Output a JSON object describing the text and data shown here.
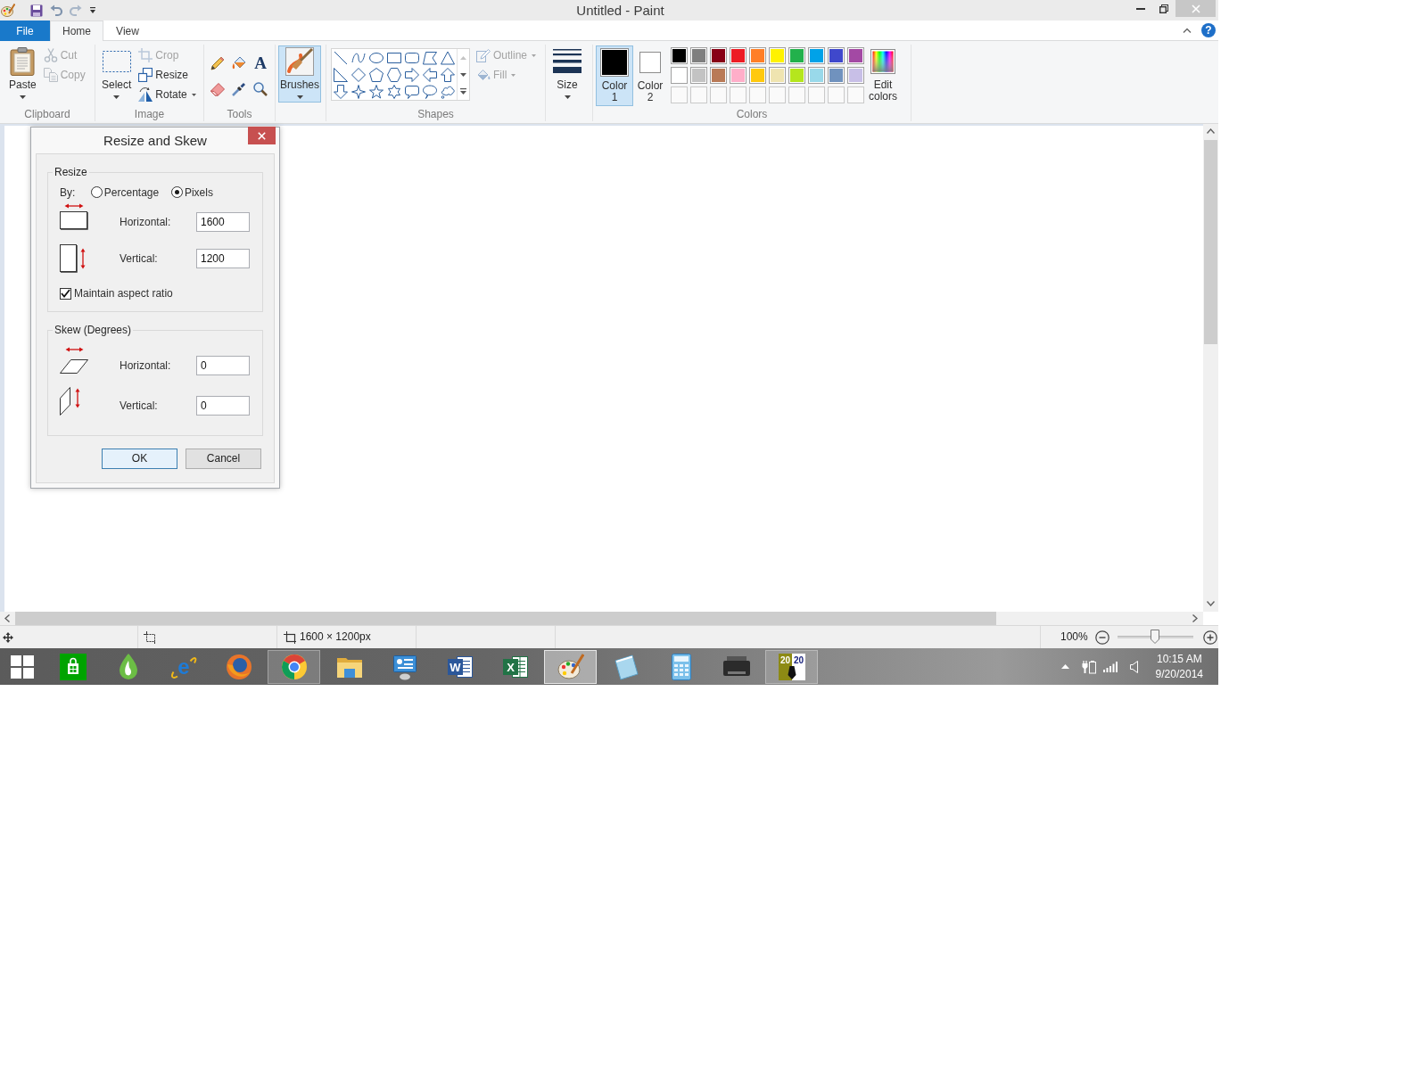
{
  "window": {
    "title": "Untitled - Paint"
  },
  "ribbon_tabs": [
    {
      "label": "File",
      "kind": "file",
      "selected": false
    },
    {
      "label": "Home",
      "kind": "tab",
      "selected": true
    },
    {
      "label": "View",
      "kind": "tab",
      "selected": false
    }
  ],
  "help_button": {
    "label": "?"
  },
  "ribbon": {
    "clipboard": {
      "title": "Clipboard",
      "paste": {
        "label": "Paste"
      },
      "cut": {
        "label": "Cut",
        "disabled": true
      },
      "copy": {
        "label": "Copy",
        "disabled": true
      }
    },
    "image": {
      "title": "Image",
      "select": {
        "label": "Select"
      },
      "crop": {
        "label": "Crop",
        "disabled": true
      },
      "resize": {
        "label": "Resize",
        "disabled": false
      },
      "rotate": {
        "label": "Rotate",
        "disabled": false
      }
    },
    "tools": {
      "title": "Tools",
      "text_tool": {
        "glyph": "A"
      }
    },
    "brushes": {
      "label": "Brushes",
      "selected": true
    },
    "shapes": {
      "title": "Shapes",
      "outline": {
        "label": "Outline",
        "disabled": true
      },
      "fill": {
        "label": "Fill",
        "disabled": true
      }
    },
    "size": {
      "label": "Size"
    },
    "colors": {
      "title": "Colors",
      "color_1": {
        "label": "Color 1",
        "color": "#000000",
        "selected": true
      },
      "color_2": {
        "label": "Color 2",
        "color": "#ffffff",
        "selected": false
      },
      "palette": [
        {
          "kind": "swatch",
          "color": "#000000"
        },
        {
          "kind": "swatch",
          "color": "#7f7f7f"
        },
        {
          "kind": "swatch",
          "color": "#880015"
        },
        {
          "kind": "swatch",
          "color": "#ed1c24"
        },
        {
          "kind": "swatch",
          "color": "#ff7f27"
        },
        {
          "kind": "swatch",
          "color": "#fff200"
        },
        {
          "kind": "swatch",
          "color": "#22b14c"
        },
        {
          "kind": "swatch",
          "color": "#00a2e8"
        },
        {
          "kind": "swatch",
          "color": "#3f48cc"
        },
        {
          "kind": "swatch",
          "color": "#a349a4"
        },
        {
          "kind": "swatch",
          "color": "#ffffff"
        },
        {
          "kind": "swatch",
          "color": "#c3c3c3"
        },
        {
          "kind": "swatch",
          "color": "#b97a57"
        },
        {
          "kind": "swatch",
          "color": "#ffaec9"
        },
        {
          "kind": "swatch",
          "color": "#ffc90e"
        },
        {
          "kind": "swatch",
          "color": "#efe4b0"
        },
        {
          "kind": "swatch",
          "color": "#b5e61d"
        },
        {
          "kind": "swatch",
          "color": "#99d9ea"
        },
        {
          "kind": "swatch",
          "color": "#7092be"
        },
        {
          "kind": "swatch",
          "color": "#c8bfe7"
        },
        {
          "kind": "empty"
        },
        {
          "kind": "empty"
        },
        {
          "kind": "empty"
        },
        {
          "kind": "empty"
        },
        {
          "kind": "empty"
        },
        {
          "kind": "empty"
        },
        {
          "kind": "empty"
        },
        {
          "kind": "empty"
        },
        {
          "kind": "empty"
        },
        {
          "kind": "empty"
        }
      ],
      "edit_colors": {
        "label": "Edit colors"
      }
    }
  },
  "dialog": {
    "title": "Resize and Skew",
    "resize": {
      "title": "Resize",
      "by_label": "By:",
      "options": [
        {
          "label": "Percentage",
          "selected": false
        },
        {
          "label": "Pixels",
          "selected": true
        }
      ],
      "fields": [
        {
          "kind": "horizontal",
          "label": "Horizontal:",
          "value": "1600"
        },
        {
          "kind": "vertical",
          "label": "Vertical:",
          "value": "1200"
        }
      ],
      "maintain_aspect_ratio": {
        "label": "Maintain aspect ratio",
        "checked": true
      }
    },
    "skew": {
      "title": "Skew (Degrees)",
      "fields": [
        {
          "kind": "horizontal",
          "label": "Horizontal:",
          "value": "0"
        },
        {
          "kind": "vertical",
          "label": "Vertical:",
          "value": "0"
        }
      ]
    },
    "buttons": [
      {
        "kind": "default",
        "label": "OK"
      },
      {
        "kind": "normal",
        "label": "Cancel"
      }
    ]
  },
  "status_bar": {
    "canvas_size": "1600 × 1200px",
    "zoom": {
      "reading": "100%",
      "level": 0.5
    }
  },
  "taskbar": {
    "apps": [
      {
        "kind": "store",
        "running": false,
        "active": false
      },
      {
        "kind": "dictation",
        "running": false,
        "active": false
      },
      {
        "kind": "ie",
        "glyph": "e",
        "running": false,
        "active": false
      },
      {
        "kind": "firefox",
        "running": false,
        "active": false
      },
      {
        "kind": "chrome",
        "running": true,
        "active": false
      },
      {
        "kind": "explorer",
        "running": false,
        "active": false
      },
      {
        "kind": "remote",
        "running": false,
        "active": false
      },
      {
        "kind": "word",
        "glyph": "W",
        "running": false,
        "active": false
      },
      {
        "kind": "excel",
        "glyph": "X",
        "running": false,
        "active": false
      },
      {
        "kind": "paint",
        "running": true,
        "active": true
      },
      {
        "kind": "journal",
        "running": false,
        "active": false
      },
      {
        "kind": "calculator",
        "running": false,
        "active": false
      },
      {
        "kind": "printer",
        "running": false,
        "active": false
      },
      {
        "kind": "app2020",
        "glyphs": [
          "20",
          "20"
        ],
        "running": true,
        "active": false
      }
    ],
    "clock": {
      "time": "10:15 AM",
      "date": "9/20/2014"
    }
  }
}
